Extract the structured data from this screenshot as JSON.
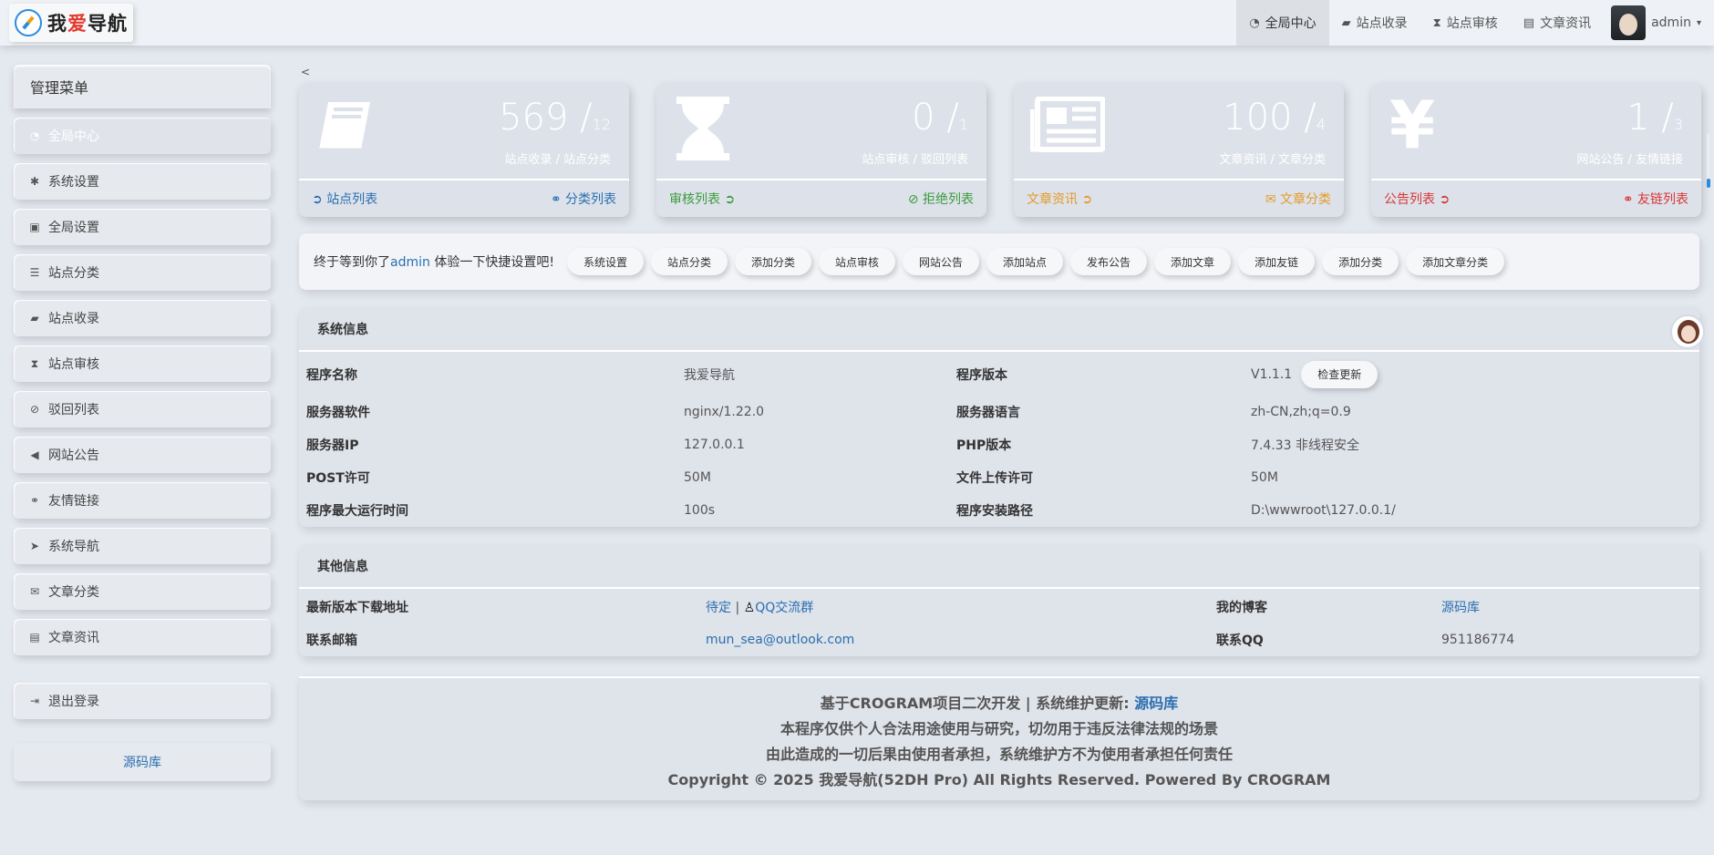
{
  "header": {
    "logo_text_1": "我",
    "logo_text_2": "爱",
    "logo_text_3": "导航",
    "nav": [
      {
        "label": "全局中心",
        "icon": "dashboard-icon"
      },
      {
        "label": "站点收录",
        "icon": "book-icon"
      },
      {
        "label": "站点审核",
        "icon": "hourglass-icon"
      },
      {
        "label": "文章资讯",
        "icon": "newspaper-icon"
      }
    ],
    "user": "admin"
  },
  "sidebar": {
    "title": "管理菜单",
    "items": [
      {
        "label": "全局中心",
        "icon": "dashboard-icon"
      },
      {
        "label": "系统设置",
        "icon": "gear-icon"
      },
      {
        "label": "全局设置",
        "icon": "image-icon"
      },
      {
        "label": "站点分类",
        "icon": "sliders-icon"
      },
      {
        "label": "站点收录",
        "icon": "book-icon"
      },
      {
        "label": "站点审核",
        "icon": "hourglass-icon"
      },
      {
        "label": "驳回列表",
        "icon": "ban-icon"
      },
      {
        "label": "网站公告",
        "icon": "bullhorn-icon"
      },
      {
        "label": "友情链接",
        "icon": "handshake-icon"
      },
      {
        "label": "系统导航",
        "icon": "location-arrow-icon"
      },
      {
        "label": "文章分类",
        "icon": "envelope-icon"
      },
      {
        "label": "文章资讯",
        "icon": "newspaper-icon"
      }
    ],
    "logout": "退出登录",
    "link": "源码库"
  },
  "back_label": "<",
  "cards": [
    {
      "num": "569 /",
      "den": "12",
      "sub": "站点收录 / 站点分类",
      "left": "站点列表",
      "right": "分类列表",
      "icon": "book-icon",
      "color": "#2a6fb0"
    },
    {
      "num": "0 /",
      "den": "1",
      "sub": "站点审核 / 驳回列表",
      "left": "审核列表",
      "right": "拒绝列表",
      "icon": "hourglass-icon",
      "color": "#3c9a3c"
    },
    {
      "num": "100 /",
      "den": "4",
      "sub": "文章资讯 / 文章分类",
      "left": "文章资讯",
      "right": "文章分类",
      "icon": "newspaper-icon",
      "color": "#e59a26"
    },
    {
      "num": "1 /",
      "den": "3",
      "sub": "网站公告 / 友情链接",
      "left": "公告列表",
      "right": "友链列表",
      "icon": "yen-icon",
      "color": "#d93535"
    }
  ],
  "quick": {
    "welcome_prefix": "终于等到你了",
    "user": "admin",
    "welcome_suffix": " 体验一下快捷设置吧!",
    "buttons": [
      "系统设置",
      "站点分类",
      "添加分类",
      "站点审核",
      "网站公告",
      "添加站点",
      "发布公告",
      "添加文章",
      "添加友链",
      "添加分类",
      "添加文章分类"
    ]
  },
  "sysinfo": {
    "title": "系统信息",
    "rows": [
      [
        "程序名称",
        "我爱导航",
        "程序版本",
        "V1.1.1"
      ],
      [
        "服务器软件",
        "nginx/1.22.0",
        "服务器语言",
        "zh-CN,zh;q=0.9"
      ],
      [
        "服务器IP",
        "127.0.0.1",
        "PHP版本",
        "7.4.33 非线程安全"
      ],
      [
        "POST许可",
        "50M",
        "文件上传许可",
        "50M"
      ],
      [
        "程序最大运行时间",
        "100s",
        "程序安装路径",
        "D:\\wwwroot\\127.0.0.1/"
      ]
    ],
    "check_update": "检查更新"
  },
  "other": {
    "title": "其他信息",
    "download_label": "最新版本下载地址",
    "download_pending": "待定",
    "separator": " | ",
    "qq_group": "QQ交流群",
    "blog_label": "我的博客",
    "blog_value": "源码库",
    "email_label": "联系邮箱",
    "email_value": "mun_sea@outlook.com",
    "qq_label": "联系QQ",
    "qq_value": "951186774"
  },
  "footer": {
    "line1_prefix": "基于CROGRAM项目二次开发 | 系统维护更新: ",
    "line1_link": "源码库",
    "line2": "本程序仅供个人合法用途使用与研究，切勿用于违反法律法规的场景",
    "line3": "由此造成的一切后果由使用者承担，系统维护方不为使用者承担任何责任",
    "line4": "Copyright © 2025 我爱导航(52DH Pro) All Rights Reserved. Powered By CROGRAM"
  }
}
